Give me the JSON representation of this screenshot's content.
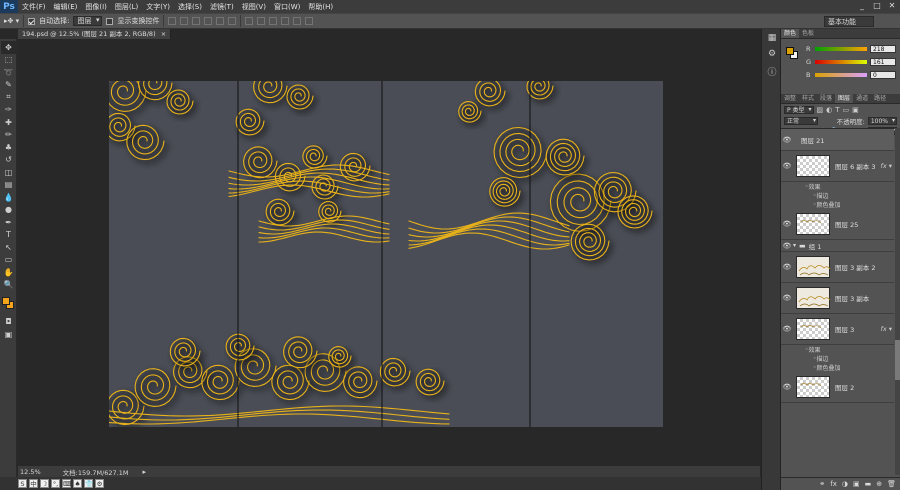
{
  "app": {
    "logo": "Ps"
  },
  "menu": [
    "文件(F)",
    "编辑(E)",
    "图像(I)",
    "图层(L)",
    "文字(Y)",
    "选择(S)",
    "滤镜(T)",
    "视图(V)",
    "窗口(W)",
    "帮助(H)"
  ],
  "window_controls": [
    "_",
    "□",
    "✕"
  ],
  "options": {
    "auto_select_label": "自动选择:",
    "auto_select_checked": true,
    "auto_select_value": "图层",
    "show_transform_label": "显示变换控件",
    "show_transform_checked": false,
    "workspace": "基本功能"
  },
  "document": {
    "tab_title": "194.psd @ 12.5% (图层 21 副本 2, RGB/8)",
    "close": "×"
  },
  "status": {
    "zoom": "12.5%",
    "doc_info": "文档:159.7M/627.1M",
    "arrow": "▸"
  },
  "tools": [
    "move-tool",
    "marquee-tool",
    "lasso-tool",
    "quick-select-tool",
    "crop-tool",
    "eyedropper-tool",
    "healing-tool",
    "brush-tool",
    "clone-stamp-tool",
    "history-brush-tool",
    "eraser-tool",
    "gradient-tool",
    "blur-tool",
    "dodge-tool",
    "pen-tool",
    "type-tool",
    "path-select-tool",
    "shape-tool",
    "hand-tool",
    "zoom-tool"
  ],
  "tool_glyphs": [
    "✥",
    "⬚",
    "➰",
    "✎",
    "⌗",
    "✑",
    "✚",
    "✏",
    "♣",
    "↺",
    "◫",
    "▤",
    "💧",
    "●",
    "✒",
    "T",
    "↖",
    "▭",
    "✋",
    "🔍"
  ],
  "colors": {
    "foreground": "#f2a51d",
    "background": "#f2a51d",
    "cloud_gold": "#e8b21a",
    "canvas_bg": "#4a4d55"
  },
  "color_panel": {
    "tabs": [
      "颜色",
      "色板"
    ],
    "active_tab": 0,
    "r_label": "R",
    "g_label": "G",
    "b_label": "B",
    "r": "218",
    "g": "161",
    "b": "0"
  },
  "layers_tabs": [
    "调整",
    "样式",
    "段落",
    "图层",
    "通道",
    "路径"
  ],
  "layers_active_tab": 3,
  "layers_panel": {
    "filter_kind": "P 类型",
    "blend_mode": "正常",
    "opacity_label": "不透明度:",
    "opacity_value": "100%",
    "lock_label": "锁定:",
    "fill_label": "填充:",
    "fill_value": "100%"
  },
  "layers": [
    {
      "type": "layer",
      "name": "图层 21",
      "thumb": "none",
      "fx": ""
    },
    {
      "type": "layer",
      "name": "图层 6 副本 3",
      "thumb": "checker",
      "fx": "fx ▾"
    },
    {
      "type": "effects",
      "name": "效果"
    },
    {
      "type": "effect_item",
      "name": "描边"
    },
    {
      "type": "effect_item",
      "name": "颜色叠加"
    },
    {
      "type": "layer",
      "name": "图层 25",
      "thumb": "checker",
      "fx": ""
    },
    {
      "type": "group",
      "name": "组 1"
    },
    {
      "type": "layer",
      "name": "图层 3 副本 2",
      "thumb": "art",
      "fx": ""
    },
    {
      "type": "layer",
      "name": "图层 3 副本",
      "thumb": "art",
      "fx": ""
    },
    {
      "type": "layer",
      "name": "图层 3",
      "thumb": "checker",
      "fx": "fx ▾"
    },
    {
      "type": "effects",
      "name": "效果"
    },
    {
      "type": "effect_item",
      "name": "描边"
    },
    {
      "type": "effect_item",
      "name": "颜色叠加"
    },
    {
      "type": "layer",
      "name": "图层 2",
      "thumb": "checker",
      "fx": ""
    }
  ],
  "layers_footer": [
    "⚭",
    "fx",
    "◑",
    "▣",
    "▬",
    "⊕",
    "🗑"
  ],
  "taskbar_ime": [
    "S",
    "中",
    "☽",
    "°,",
    "⌨",
    "♠",
    "👕",
    "⚙"
  ]
}
